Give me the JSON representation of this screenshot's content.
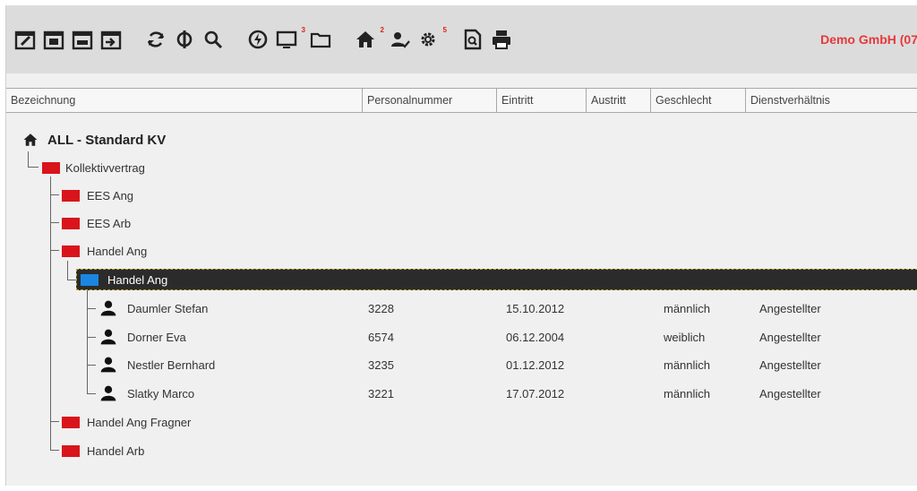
{
  "toolbar": {
    "icons": [
      {
        "name": "calendar-edit-icon"
      },
      {
        "name": "calendar-icon"
      },
      {
        "name": "calendar-view-icon"
      },
      {
        "name": "calendar-next-icon"
      },
      {
        "name": "refresh-icon"
      },
      {
        "name": "sync-icon"
      },
      {
        "name": "search-icon"
      },
      {
        "name": "power-icon"
      },
      {
        "name": "monitor-icon",
        "badge": "3"
      },
      {
        "name": "folder-icon"
      },
      {
        "name": "home-icon",
        "badge": "2"
      },
      {
        "name": "users-icon"
      },
      {
        "name": "settings-icon",
        "badge": "5"
      },
      {
        "name": "document-search-icon"
      },
      {
        "name": "print-icon"
      }
    ],
    "company": "Demo GmbH (07"
  },
  "columns": [
    "Bezeichnung",
    "Personalnummer",
    "Eintritt",
    "Austritt",
    "Geschlecht",
    "Dienstverhältnis"
  ],
  "tree": {
    "root": "ALL - Standard KV",
    "kv": "Kollektivvertrag",
    "groups": [
      "EES Ang",
      "EES Arb",
      "Handel Ang"
    ],
    "selected": "Handel Ang",
    "employees": [
      {
        "name": "Daumler Stefan",
        "nr": "3228",
        "eintritt": "15.10.2012",
        "austritt": "",
        "geschlecht": "männlich",
        "dienst": "Angestellter"
      },
      {
        "name": "Dorner Eva",
        "nr": "6574",
        "eintritt": "06.12.2004",
        "austritt": "",
        "geschlecht": "weiblich",
        "dienst": "Angestellter"
      },
      {
        "name": "Nestler Bernhard",
        "nr": "3235",
        "eintritt": "01.12.2012",
        "austritt": "",
        "geschlecht": "männlich",
        "dienst": "Angestellter"
      },
      {
        "name": "Slatky Marco",
        "nr": "3221",
        "eintritt": "17.07.2012",
        "austritt": "",
        "geschlecht": "männlich",
        "dienst": "Angestellter"
      }
    ],
    "after_groups": [
      "Handel Ang Fragner",
      "Handel Arb"
    ]
  },
  "colors": {
    "accent_company": "#e8383a",
    "folder_red": "#d9141b",
    "folder_blue": "#1b86e0",
    "selected_bg": "#2b2b2b"
  }
}
